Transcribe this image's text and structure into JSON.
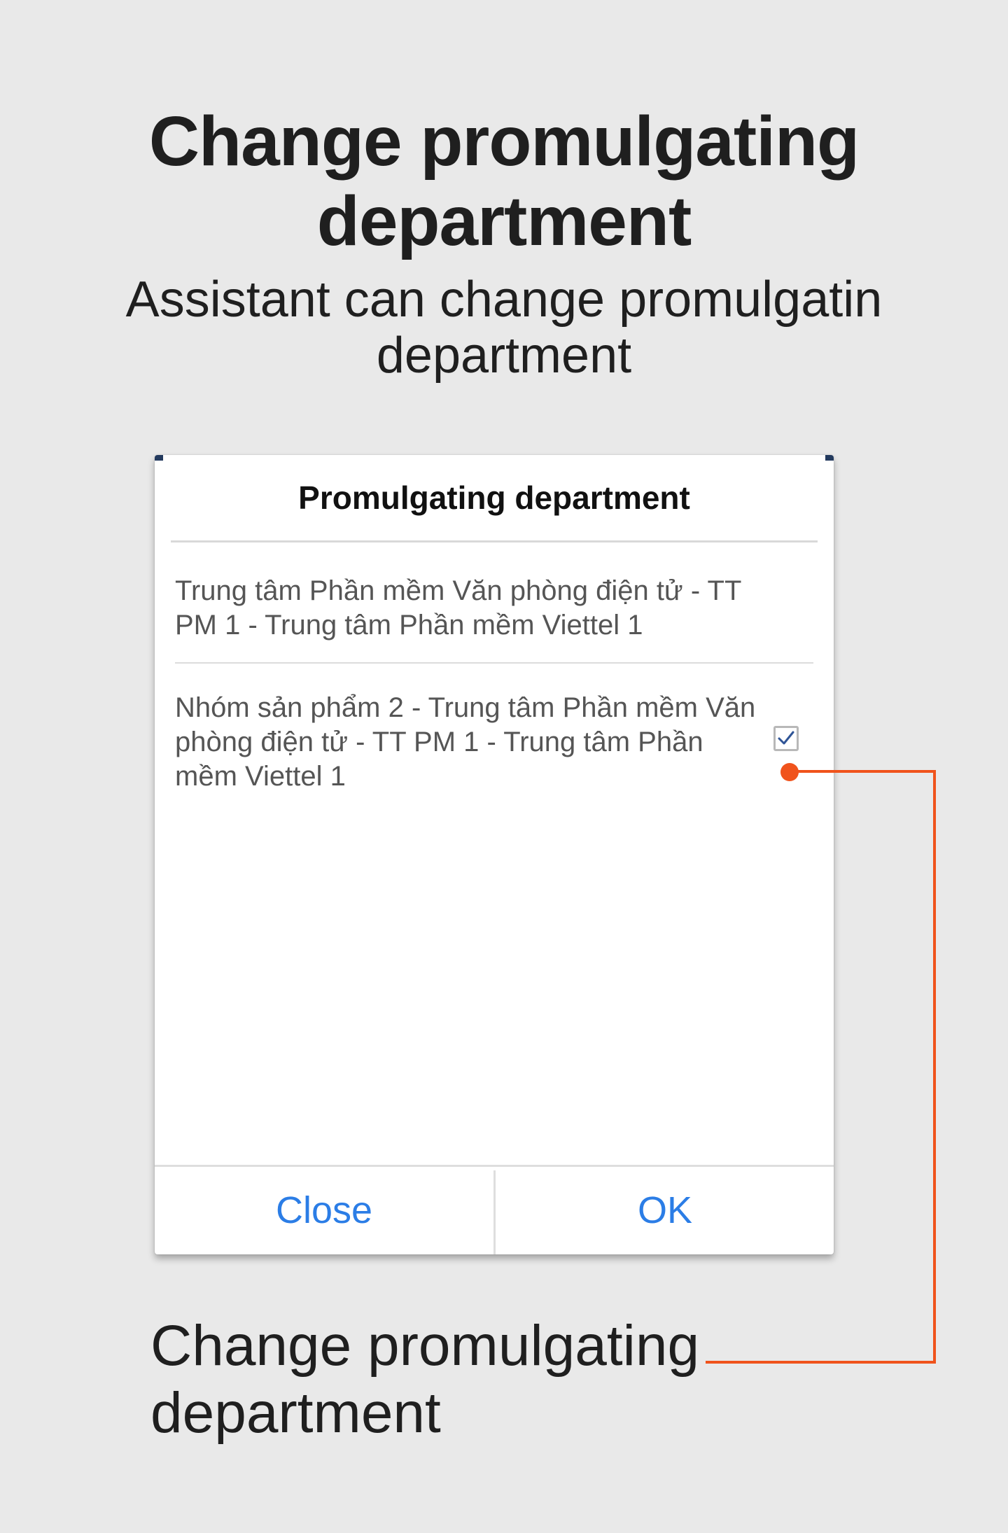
{
  "header": {
    "title": "Change promulgating department",
    "subtitle": "Assistant can change promulgatin department"
  },
  "dialog": {
    "title": "Promulgating department",
    "options": [
      {
        "label": "Trung tâm Phần mềm Văn phòng điện tử - TT PM 1 - Trung tâm Phần mềm Viettel 1",
        "checked": false
      },
      {
        "label": "Nhóm sản phẩm 2 - Trung tâm Phần mềm Văn phòng điện tử - TT PM 1 - Trung tâm Phần mềm Viettel 1",
        "checked": true
      }
    ],
    "close_label": "Close",
    "ok_label": "OK"
  },
  "callout": {
    "label": "Change promulgating department"
  },
  "colors": {
    "background": "#e9e9e9",
    "accent": "#2b7de6",
    "callout": "#f0531c",
    "checkmark": "#2f5496"
  }
}
